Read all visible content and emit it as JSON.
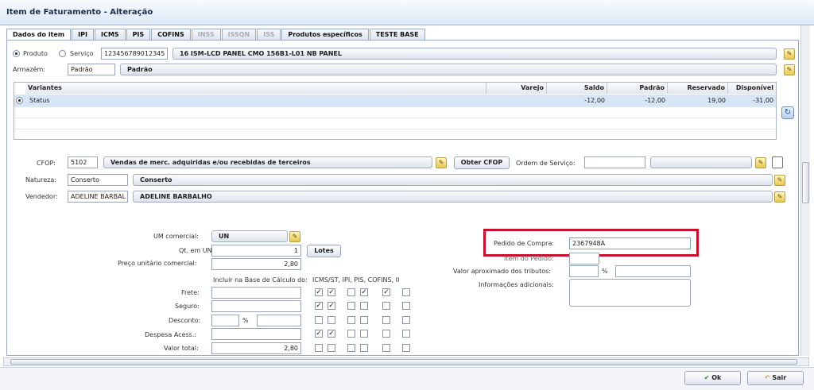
{
  "window": {
    "title": "Item de Faturamento - Alteração"
  },
  "tabs": [
    {
      "label": "Dados do item",
      "state": "active"
    },
    {
      "label": "IPI",
      "state": "normal"
    },
    {
      "label": "ICMS",
      "state": "normal"
    },
    {
      "label": "PIS",
      "state": "normal"
    },
    {
      "label": "COFINS",
      "state": "normal"
    },
    {
      "label": "INSS",
      "state": "disabled"
    },
    {
      "label": "ISSQN",
      "state": "disabled"
    },
    {
      "label": "ISS",
      "state": "disabled"
    },
    {
      "label": "Produtos específicos",
      "state": "normal"
    },
    {
      "label": "TESTE BASE",
      "state": "normal"
    }
  ],
  "product": {
    "radio_produto": "Produto",
    "radio_servico": "Serviço",
    "code": "123456789012345",
    "name": "16 ISM-LCD PANEL CMO 156B1-L01 NB PANEL"
  },
  "warehouse": {
    "label": "Armazém:",
    "code": "Padrão",
    "name": "Padrão"
  },
  "variants": {
    "headers": [
      "Variantes",
      "Varejo",
      "Saldo",
      "Padrão",
      "Reservado",
      "Disponível"
    ],
    "row": {
      "name": "Status",
      "varejo": "",
      "saldo": "-12,00",
      "padrao": "-12,00",
      "reservado": "19,00",
      "disponivel": "-31,00"
    }
  },
  "cfop": {
    "label": "CFOP:",
    "code": "5102",
    "desc": "Vendas de merc. adquiridas e/ou recebidas de terceiros",
    "button": "Obter CFOP",
    "os_label": "Ordem de Serviço:",
    "os_value": ""
  },
  "nature": {
    "label": "Natureza:",
    "code": "Conserto",
    "name": "Conserto"
  },
  "seller": {
    "label": "Vendedor:",
    "code": "ADELINE BARBAL",
    "name": "ADELINE BARBALHO"
  },
  "commercial": {
    "um_label": "UM comercial:",
    "um_value": "UN",
    "qt_label": "Qt. em UN:",
    "qt_value": "1",
    "lotes_button": "Lotes",
    "price_label": "Preço unitário comercial:",
    "price_value": "2,80"
  },
  "taxes": {
    "base_header": "Incluir na Base de Cálculo do:",
    "tax_header": "ICMS/ST, IPI, PIS, COFINS, II",
    "frete": "Frete:",
    "seguro": "Seguro:",
    "desconto": "Desconto:",
    "percent": "%",
    "despesa": "Despesa Acess.:",
    "total_label": "Valor total:",
    "total_value": "2,80"
  },
  "checkbox_rows": [
    [
      true,
      true,
      false,
      true,
      true,
      false
    ],
    [
      true,
      true,
      false,
      false,
      false,
      false
    ],
    [
      false,
      false,
      false,
      false,
      false,
      false
    ],
    [
      true,
      true,
      false,
      false,
      false,
      false
    ],
    [
      false,
      false,
      false,
      false,
      false,
      false
    ]
  ],
  "order": {
    "pedido_label": "Pedido de Compra:",
    "pedido_value": "2367948A",
    "item_label": "Item do Pedido:",
    "tributos_label": "Valor aproximado dos tributos:",
    "percent": "%",
    "info_label": "Informações adicionais:"
  },
  "footer": {
    "ok": "Ok",
    "exit": "Sair"
  },
  "colors": {
    "highlight": "#c8102e",
    "selected_row": "#d6e6f7"
  }
}
